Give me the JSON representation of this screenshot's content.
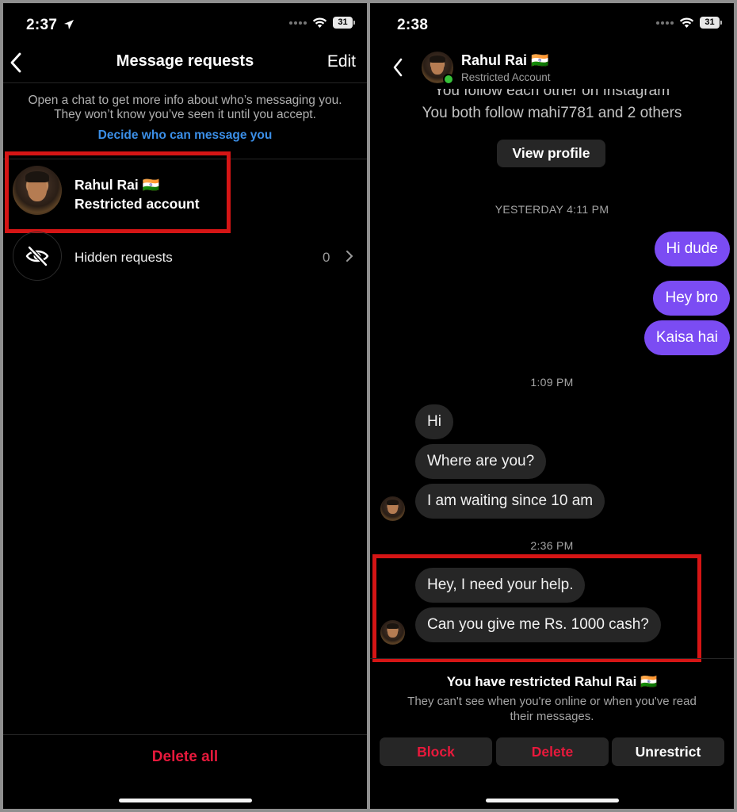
{
  "left": {
    "status": {
      "time": "2:37",
      "battery": "31"
    },
    "nav": {
      "title": "Message requests",
      "edit": "Edit"
    },
    "info": {
      "line1": "Open a chat to get more info about who’s messaging you.",
      "line2": "They won’t know you’ve seen it until you accept.",
      "link": "Decide who can message you"
    },
    "request": {
      "name": "Rahul Rai 🇮🇳",
      "subtitle": "Restricted account"
    },
    "hidden": {
      "label": "Hidden requests",
      "count": "0"
    },
    "delete_all": "Delete all"
  },
  "right": {
    "status": {
      "time": "2:38",
      "battery": "31"
    },
    "header": {
      "name": "Rahul Rai 🇮🇳",
      "subtitle": "Restricted Account"
    },
    "mutual": {
      "line1": "You follow each other on Instagram",
      "line2": "You both follow mahi7781 and 2 others"
    },
    "view_profile": "View profile",
    "stamps": [
      "YESTERDAY 4:11 PM",
      "1:09 PM",
      "2:36 PM"
    ],
    "outgoing": [
      "Hi dude",
      "Hey bro",
      "Kaisa hai"
    ],
    "incoming_1": [
      "Hi",
      "Where are you?",
      "I am waiting since 10 am"
    ],
    "incoming_2": [
      "Hey, I need your help.",
      "Can you give me Rs. 1000 cash?"
    ],
    "restricted": {
      "title": "You have restricted Rahul Rai 🇮🇳",
      "line1": "They can't see when you're online or when you've read",
      "line2": "their messages."
    },
    "actions": {
      "block": "Block",
      "delete": "Delete",
      "unrestrict": "Unrestrict"
    }
  },
  "colors": {
    "accent_blue": "#3b8fe8",
    "danger_red": "#e8193c",
    "outgoing_bubble": "#7b4cf3",
    "incoming_bubble": "#262626",
    "highlight_box": "#d51515",
    "online_dot": "#37c23a"
  },
  "icons": [
    "location-arrow-icon",
    "cellular-signal-icon",
    "wifi-icon",
    "battery-icon",
    "back-chevron-icon",
    "hidden-eye-icon",
    "chevron-right-icon"
  ]
}
